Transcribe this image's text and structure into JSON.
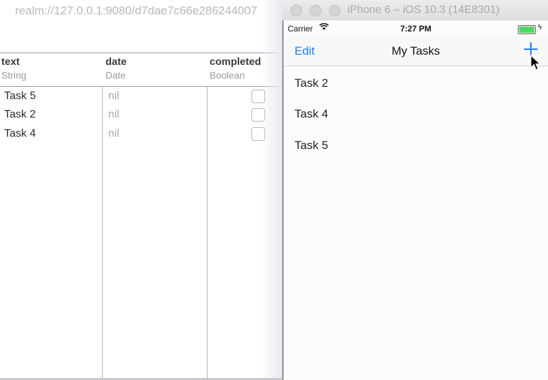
{
  "realm": {
    "window_title": "realm://127.0.0.1:9080/d7dae7c66e286244007",
    "columns": [
      {
        "name": "text",
        "type": "String"
      },
      {
        "name": "date",
        "type": "Date"
      },
      {
        "name": "completed",
        "type": "Boolean"
      }
    ],
    "rows": [
      {
        "text": "Task 5",
        "date": "nil",
        "completed": false
      },
      {
        "text": "Task 2",
        "date": "nil",
        "completed": false
      },
      {
        "text": "Task 4",
        "date": "nil",
        "completed": false
      }
    ]
  },
  "simulator": {
    "window_title": "iPhone 6 – iOS 10.3 (14E8301)",
    "status_bar": {
      "carrier": "Carrier",
      "time": "7:27 PM",
      "battery_level": 1.0
    },
    "nav": {
      "left_button": "Edit",
      "title": "My Tasks",
      "right_icon": "plus-icon"
    },
    "tasks": [
      "Task 2",
      "Task 4",
      "Task 5"
    ]
  },
  "colors": {
    "ios_tint": "#1a7cf4",
    "battery_green": "#4cd964"
  }
}
